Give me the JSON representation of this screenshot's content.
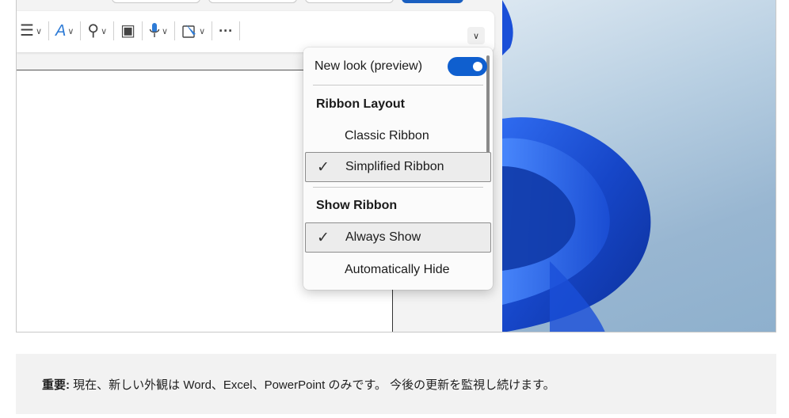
{
  "menu": {
    "new_look_label": "New look (preview)",
    "new_look_toggle": "on",
    "ribbon_layout_heading": "Ribbon Layout",
    "classic_ribbon": "Classic Ribbon",
    "simplified_ribbon": "Simplified Ribbon",
    "selected_layout": "Simplified Ribbon",
    "show_ribbon_heading": "Show Ribbon",
    "always_show": "Always Show",
    "automatically_hide": "Automatically Hide",
    "selected_show": "Always Show",
    "check_glyph": "✓"
  },
  "ribbon": {
    "tools": [
      {
        "icon": "list-icon",
        "glyph": "☰"
      },
      {
        "icon": "editor-pen-icon",
        "glyph": "A"
      },
      {
        "icon": "search-icon",
        "glyph": "⚲"
      },
      {
        "icon": "reading-view-icon",
        "glyph": "▣"
      },
      {
        "icon": "dictate-mic-icon",
        "glyph": "🎙"
      },
      {
        "icon": "designer-icon",
        "glyph": "✎"
      }
    ],
    "more_glyph": "···",
    "chevron_glyph": "∨"
  },
  "note": {
    "label": "重要:",
    "text": "現在、新しい外観は Word、Excel、PowerPoint のみです。 今後の更新を監視し続けます。"
  },
  "colors": {
    "accent": "#0f5fcf",
    "wallpaper_swirl": "#1a4fd8"
  }
}
